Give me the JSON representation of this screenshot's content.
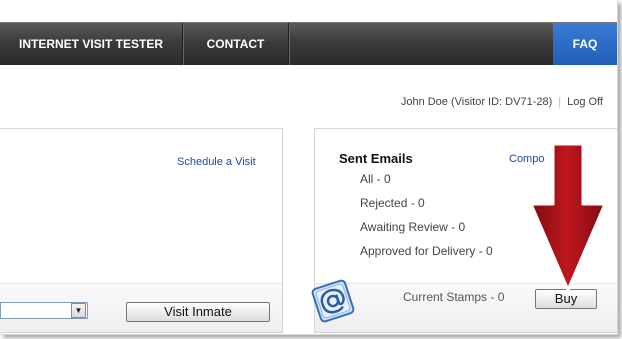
{
  "nav": {
    "items": [
      "INTERNET VISIT TESTER",
      "CONTACT",
      "FAQ"
    ]
  },
  "user": {
    "name_label": "John Doe (Visitor ID: DV71-28)",
    "logoff": "Log Off"
  },
  "left_panel": {
    "schedule_link": "Schedule a Visit",
    "visit_button": "Visit Inmate"
  },
  "right_panel": {
    "title": "Sent Emails",
    "compose_link": "Compo",
    "stats": [
      "All - 0",
      "Rejected - 0",
      "Awaiting Review - 0",
      "Approved for Delivery - 0"
    ],
    "stamps_label": "Current Stamps - 0",
    "buy_button": "Buy"
  },
  "colors": {
    "nav_bg": "#3b3b3b",
    "faq_bg": "#2a6ac7",
    "link": "#1a4d9c",
    "arrow": "#a3121a"
  },
  "icons": [
    "email-at-icon",
    "down-arrow-annotation",
    "dropdown-arrow-icon"
  ]
}
